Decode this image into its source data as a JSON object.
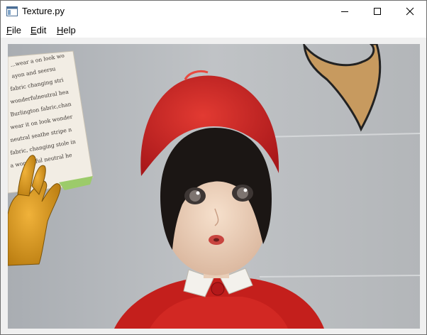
{
  "window": {
    "title": "Texture.py",
    "icon": "window-app-icon",
    "controls": [
      "minimize-icon",
      "maximize-icon",
      "close-icon"
    ]
  },
  "menubar": {
    "items": [
      {
        "accel": "F",
        "rest": "ile"
      },
      {
        "accel": "E",
        "rest": "dit"
      },
      {
        "accel": "H",
        "rest": "elp"
      }
    ]
  },
  "canvas": {
    "book_lines": [
      "...wear a on look wo",
      "ayon and seersu",
      "fabric changing stri",
      "wonderfulneutral hea",
      "Burlington fabric,chan",
      "wear it on look wonder",
      "neutral seathe stripe n",
      "fabric, changing stole in",
      "a wonderful neutral he"
    ]
  }
}
